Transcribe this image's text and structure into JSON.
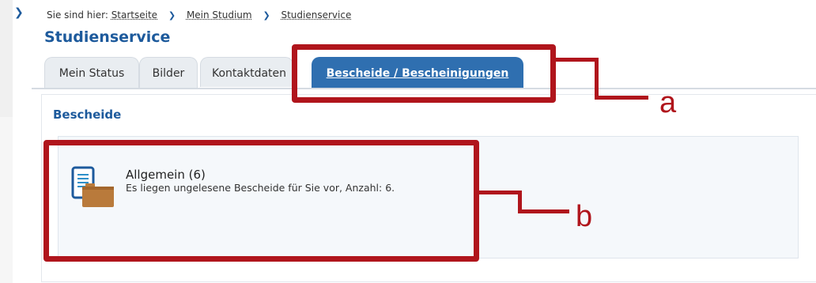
{
  "breadcrumb": {
    "prefix": "Sie sind hier:",
    "items": [
      "Startseite",
      "Mein Studium",
      "Studienservice"
    ]
  },
  "page": {
    "title": "Studienservice"
  },
  "tabs": [
    {
      "label": "Mein Status",
      "active": false
    },
    {
      "label": "Bilder",
      "active": false
    },
    {
      "label": "Kontaktdaten",
      "active": false
    },
    {
      "label": "Bescheide / Bescheinigungen",
      "active": true
    }
  ],
  "section": {
    "title": "Bescheide",
    "card": {
      "title": "Allgemein (6)",
      "description": "Es liegen ungelesene Bescheide für Sie vor, Anzahl: 6.",
      "icon": "document-folder-icon"
    }
  },
  "annotations": {
    "a": "a",
    "b": "b"
  },
  "colors": {
    "accent": "#1d5a9c",
    "active_tab": "#2f6fb0",
    "annotation": "#b0151c",
    "folder": "#b97a3b"
  }
}
